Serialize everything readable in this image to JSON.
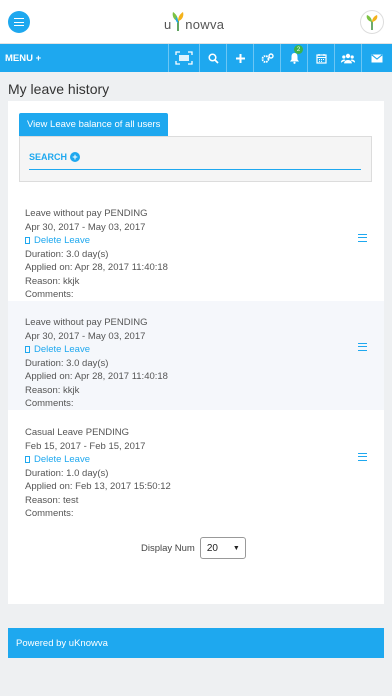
{
  "header": {
    "logo_prefix": "u",
    "logo_suffix": "nowva",
    "menu_label": "MENU +",
    "notification_count": "2"
  },
  "page": {
    "title": "My leave history",
    "balance_button": "View Leave balance of all users",
    "search_label": "SEARCH"
  },
  "leaves": [
    {
      "type_status": "Leave without pay PENDING",
      "dates": "Apr 30, 2017 - May 03, 2017",
      "delete_label": "Delete Leave",
      "duration": "Duration: 3.0 day(s)",
      "applied_on": "Applied on: Apr 28, 2017 11:40:18",
      "reason": "Reason: kkjk",
      "comments": "Comments:"
    },
    {
      "type_status": "Leave without pay PENDING",
      "dates": "Apr 30, 2017 - May 03, 2017",
      "delete_label": "Delete Leave",
      "duration": "Duration: 3.0 day(s)",
      "applied_on": "Applied on: Apr 28, 2017 11:40:18",
      "reason": "Reason: kkjk",
      "comments": "Comments:"
    },
    {
      "type_status": "Casual Leave PENDING",
      "dates": "Feb 15, 2017 - Feb 15, 2017",
      "delete_label": "Delete Leave",
      "duration": "Duration: 1.0 day(s)",
      "applied_on": "Applied on: Feb 13, 2017 15:50:12",
      "reason": "Reason: test",
      "comments": "Comments:"
    }
  ],
  "pagination": {
    "display_label": "Display Num",
    "display_value": "20"
  },
  "footer": {
    "text": "Powered by uKnowva"
  },
  "colors": {
    "accent": "#1ea8ef",
    "badge": "#3cb34a"
  }
}
